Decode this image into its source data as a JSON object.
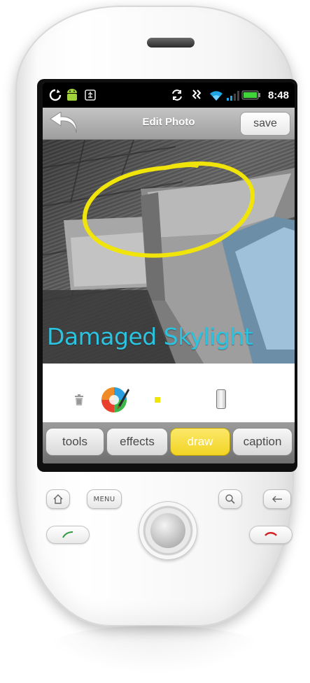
{
  "status_bar": {
    "time": "8:48",
    "icons": [
      "sync-icon",
      "android-icon",
      "usb-icon",
      "sync-icon",
      "vibrate-icon",
      "wifi-icon",
      "signal-icon",
      "battery-icon"
    ]
  },
  "header": {
    "title": "Edit Photo",
    "save_label": "save",
    "back_icon": "back-arrow-icon"
  },
  "photo": {
    "caption": "Damaged Skylight",
    "annotation_color": "#f0e40a"
  },
  "draw_tools": {
    "trash_icon": "trash-icon",
    "palette_icon": "color-palette-icon",
    "selected_color": "#f1e40a",
    "brush_size_fraction": 0.44
  },
  "tabs": [
    {
      "label": "tools",
      "active": false
    },
    {
      "label": "effects",
      "active": false
    },
    {
      "label": "draw",
      "active": true
    },
    {
      "label": "caption",
      "active": false
    }
  ],
  "hardware": {
    "menu_label": "MENU",
    "accent_call": "#2c9a3e",
    "accent_end": "#d22424"
  }
}
